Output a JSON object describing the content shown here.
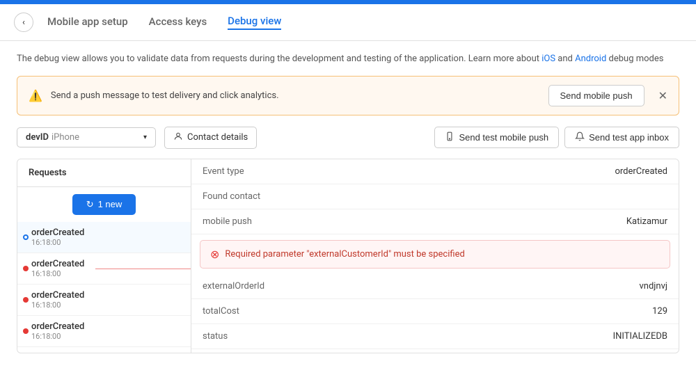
{
  "topbar": {
    "color": "#1a73e8"
  },
  "header": {
    "back_label": "‹",
    "tabs": [
      {
        "id": "mobile-app-setup",
        "label": "Mobile app setup",
        "active": false
      },
      {
        "id": "access-keys",
        "label": "Access keys",
        "active": false
      },
      {
        "id": "debug-view",
        "label": "Debug view",
        "active": true
      }
    ]
  },
  "description": {
    "text": "The debug view allows you to validate data from requests during the development and testing of the application. Learn more about ",
    "ios_link": "iOS",
    "and_text": " and ",
    "android_link": "Android",
    "suffix": " debug modes"
  },
  "banner": {
    "text": "Send a push message to test delivery and click analytics.",
    "button_label": "Send mobile push",
    "close_icon": "✕"
  },
  "toolbar": {
    "dropdown": {
      "dev_id": "devID",
      "sub_label": "iPhone",
      "chevron": "▾"
    },
    "contact_btn": {
      "icon": "👤",
      "label": "Contact details"
    },
    "action_btns": [
      {
        "id": "send-test-mobile-push",
        "icon": "🔔",
        "label": "Send test mobile push"
      },
      {
        "id": "send-test-app-inbox",
        "icon": "🔔",
        "label": "Send test app inbox"
      }
    ]
  },
  "requests": {
    "header": "Requests",
    "new_btn": "1 new",
    "items": [
      {
        "id": 1,
        "name": "orderCreated",
        "time": "16:18:00",
        "type": "selected"
      },
      {
        "id": 2,
        "name": "orderCreated",
        "time": "16:18:00",
        "type": "red"
      },
      {
        "id": 3,
        "name": "orderCreated",
        "time": "16:18:00",
        "type": "red"
      },
      {
        "id": 4,
        "name": "orderCreated",
        "time": "16:18:00",
        "type": "red"
      }
    ]
  },
  "details": {
    "rows": [
      {
        "field": "Event type",
        "value": "orderCreated"
      },
      {
        "field": "Found contact",
        "value": ""
      },
      {
        "field": "mobile push",
        "value": "Katizamur"
      }
    ],
    "error": {
      "message": "Required parameter \"externalCustomerId\" must be specified"
    },
    "extra_rows": [
      {
        "field": "externalOrderId",
        "value": "vndjnvj"
      },
      {
        "field": "totalCost",
        "value": "129"
      },
      {
        "field": "status",
        "value": "INITIALIZEDB"
      }
    ]
  }
}
